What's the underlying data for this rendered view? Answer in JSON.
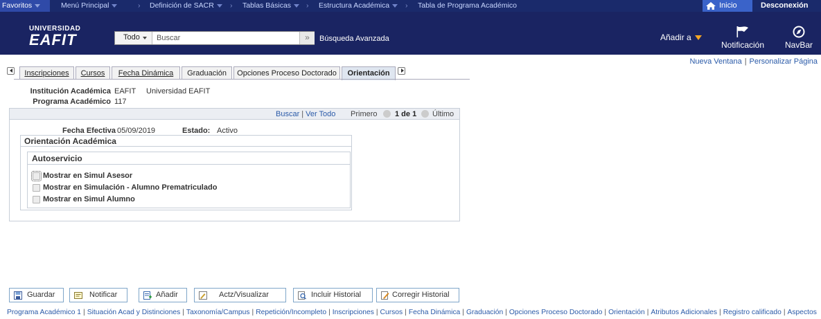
{
  "breadcrumb": {
    "favorites": "Favoritos",
    "main_menu": "Menú Principal",
    "items": [
      "Definición de SACR",
      "Tablas Básicas",
      "Estructura Académica",
      "Tabla de Programa Académico"
    ],
    "home": "Inicio",
    "logout": "Desconexión"
  },
  "header": {
    "logo_line1": "UNIVERSIDAD",
    "logo_line2": "EAFIT",
    "search_scope": "Todo",
    "search_placeholder": "Buscar",
    "advanced_search": "Búsqueda Avanzada",
    "add_to": "Añadir a",
    "notification": "Notificación",
    "navbar": "NavBar"
  },
  "links": {
    "new_window": "Nueva Ventana",
    "personalize": "Personalizar Página"
  },
  "tabs": [
    {
      "label": "Inscripciones",
      "active": false
    },
    {
      "label": "Cursos",
      "active": false
    },
    {
      "label": "Fecha Dinámica",
      "active": false
    },
    {
      "label": "Graduación",
      "active": false
    },
    {
      "label": "Opciones Proceso Doctorado",
      "active": false
    },
    {
      "label": "Orientación",
      "active": true
    }
  ],
  "keys": {
    "institution_label": "Institución Académica",
    "institution_code": "EAFIT",
    "institution_name": "Universidad EAFIT",
    "program_label": "Programa Académico",
    "program_value": "117"
  },
  "scroll": {
    "find": "Buscar",
    "view_all": "Ver Todo",
    "first": "Primero",
    "count": "1 de 1",
    "last": "Último"
  },
  "record": {
    "effdate_label": "Fecha Efectiva",
    "effdate_value": "05/09/2019",
    "status_label": "Estado:",
    "status_value": "Activo"
  },
  "orientation": {
    "title": "Orientación Académica",
    "self_service_title": "Autoservicio",
    "checkboxes": [
      {
        "label": "Mostrar en Simul Asesor",
        "checked": false
      },
      {
        "label": "Mostrar en Simulación - Alumno Prematriculado",
        "checked": false
      },
      {
        "label": "Mostrar en Simul Alumno",
        "checked": false
      }
    ]
  },
  "toolbar": {
    "save": "Guardar",
    "notify": "Notificar",
    "add": "Añadir",
    "update_display": "Actz/Visualizar",
    "include_history": "Incluir Historial",
    "correct_history": "Corregir Historial"
  },
  "footer_links": [
    "Programa Académico 1",
    "Situación Acad y Distinciones",
    "Taxonomía/Campus",
    "Repetición/Incompleto",
    "Inscripciones",
    "Cursos",
    "Fecha Dinámica",
    "Graduación",
    "Opciones Proceso Doctorado",
    "Orientación",
    "Atributos Adicionales",
    "Registro calificado",
    "Aspectos"
  ],
  "colors": {
    "topbar": "#1a2a6b",
    "header": "#1a2462",
    "link": "#2a5aa8",
    "add_to_triangle": "#f5a623"
  }
}
